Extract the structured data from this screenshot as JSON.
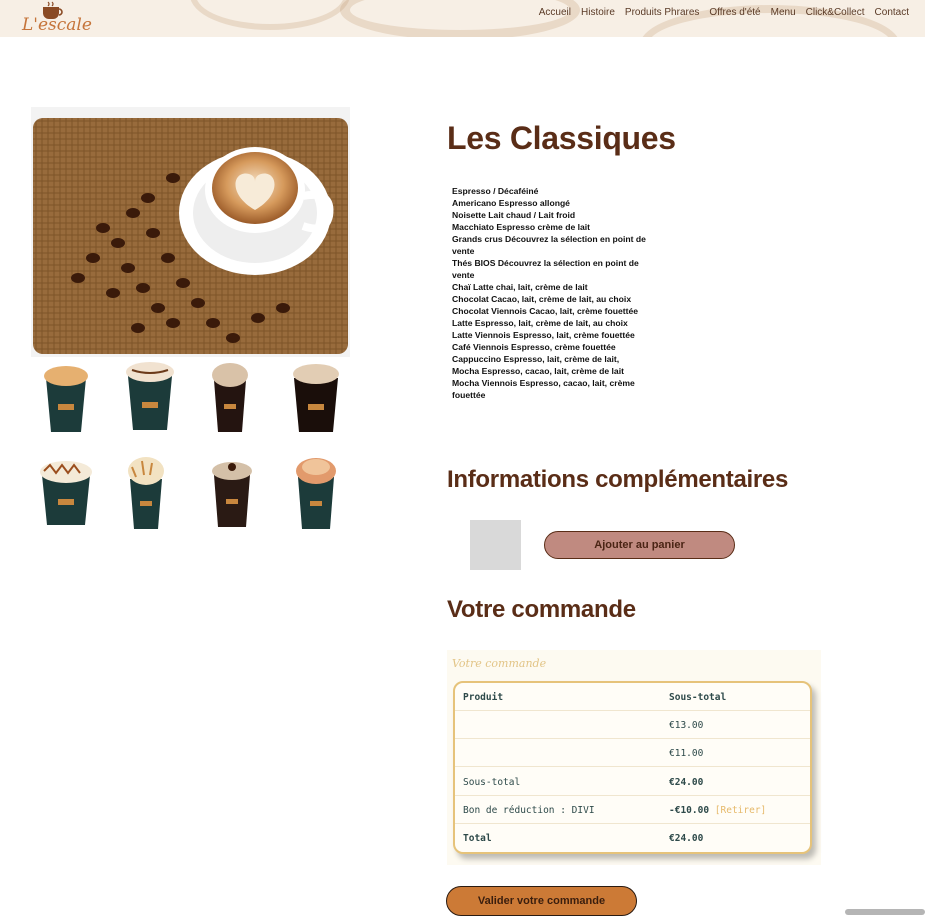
{
  "header": {
    "logo_text": "L'escale",
    "nav": [
      "Accueil",
      "Histoire",
      "Produits Phrares",
      "Offres d'été",
      "Menu",
      "Click&Collect",
      "Contact"
    ]
  },
  "product": {
    "title": "Les Classiques",
    "menu_items": [
      "Espresso / Décaféiné",
      "Americano Espresso allongé",
      "Noisette Lait chaud / Lait froid",
      "Macchiato Espresso crème de lait",
      "Grands crus Découvrez la sélection en point de vente",
      "Thés BIOS Découvrez la sélection en point de vente",
      "Chaï Latte chai, lait, crème de lait",
      "Chocolat Cacao, lait, crème de lait, au choix",
      "Chocolat Viennois Cacao, lait, crème fouettée",
      "Latte Espresso, lait, crème de lait, au choix",
      "Latte Viennois Espresso, lait, crème fouettée",
      "Café Viennois Espresso, crème fouettée",
      "Cappuccino Espresso, lait, crème de lait,",
      "Mocha Espresso, cacao, lait, crème de lait",
      "Mocha Viennois Espresso, cacao, lait, crème fouettée"
    ],
    "info_title": "Informations complémentaires",
    "add_to_cart": "Ajouter au panier"
  },
  "order": {
    "title": "Votre commande",
    "caption": "Votre commande",
    "header_product": "Produit",
    "header_subtotal": "Sous-total",
    "line1_price": "€13.00",
    "line2_price": "€11.00",
    "subtotal_label": "Sous-total",
    "subtotal_value": "€24.00",
    "coupon_label": "Bon de réduction : DIVI",
    "coupon_value": "-€10.00",
    "coupon_remove": "[Retirer]",
    "total_label": "Total",
    "total_value": "€24.00",
    "validate": "Valider votre commande"
  },
  "colors": {
    "brand_brown": "#5a2d17",
    "accent_orange": "#cc7a36",
    "cart_button": "#c08a80",
    "table_border": "#e6c37a"
  }
}
